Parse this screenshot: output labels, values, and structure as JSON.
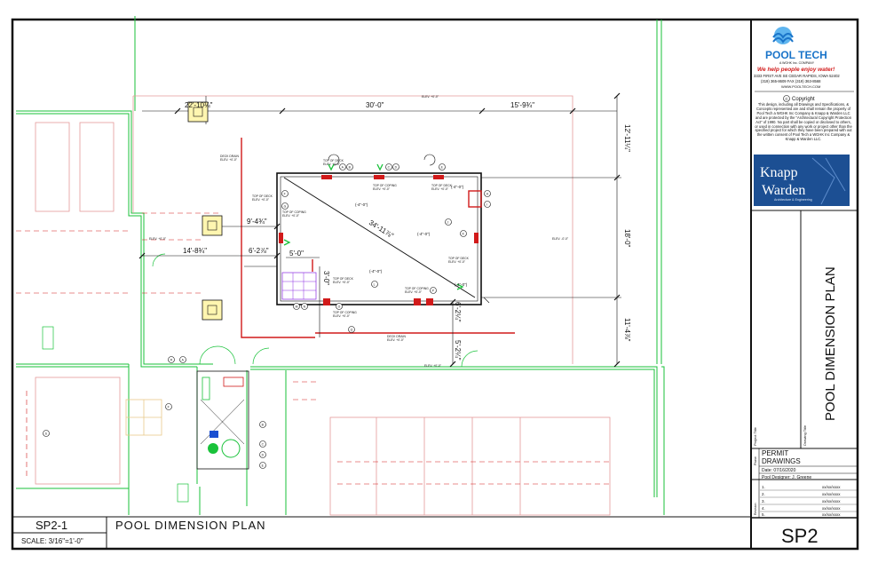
{
  "drawing": {
    "dims": {
      "top_a": "22'-10¼\"",
      "top_b": "30'-0\"",
      "top_c": "15'-9¾\"",
      "right_a": "12'-11¼\"",
      "right_b": "18'-0\"",
      "right_c": "11'-4⅞\"",
      "diag": "34'-11⅞\"",
      "left_a": "9'-4¾\"",
      "left_b": "14'-8¾\"",
      "left_c": "6'-2⅞\"",
      "step": "5'-0\"",
      "step2": "3'-0\"",
      "low_a": "6'-2¼\"",
      "low_b": "5'-2¼\""
    },
    "notes": {
      "top_of_coping": "TOP OF COPING",
      "top_of_deck": "TOP OF DECK",
      "deck_drain": "DECK DRAIN",
      "elev": "ELEV. +0'-0\"",
      "elev_neg": "ELEV. -0'-0\"",
      "elev_short": "ELEV. +0'-0\"",
      "slope": "(-4\"-0\")"
    },
    "callouts": [
      "A",
      "B",
      "C",
      "D",
      "E",
      "F",
      "G",
      "H",
      "I",
      "J",
      "K",
      "L",
      "M",
      "N",
      "O",
      "P",
      "Q",
      "R",
      "S"
    ]
  },
  "footer": {
    "sheet_ref": "SP2-1",
    "title": "POOL DIMENSION PLAN",
    "scale": "SCALE: 3/16\"=1'-0\""
  },
  "titleblock": {
    "logo_name": "POOL TECH",
    "logo_sub": "A WGHK Inc. COMPANY",
    "tagline": "We help people enjoy water!",
    "address": "3333 FIRST AVE SE CEDAR RAPIDS, IOWA 52402",
    "phone": "(319) 365-8609 FAX (319) 363-8568",
    "web": "WWW.POOLTECH.COM",
    "copyright_title": "Copyright",
    "copyright_text": "This design, including all Drawings and Specifications, & Concepts represented are and shall remain the property of Pool Tech a WGHK Inc Company & Knapp & Warden LLC and are protected by the \"Architectural Copyright Protection Act\" of 1990. No part shall be copied or disclosed to others, or used in connection with any work or project other than the specified project for which they have been prepared with out the written consent of Pool Tech a WGHK Inc Company & Knapp & Warden LLC.",
    "partner_line1": "Knapp",
    "partner_line2": "Warden",
    "partner_sub": "Architecture & Engineering",
    "project_title_label": "Project Title",
    "drawing_title_label": "Drawing Title",
    "drawing_title": "POOL DIMENSION PLAN",
    "phase_label": "Phase",
    "phase_line1": "PERMIT",
    "phase_line2": "DRAWINGS",
    "date": "Date: 07/16/2020",
    "designer": "Pool Designer: J. Greene",
    "revision_label": "Revision",
    "revisions": [
      {
        "num": "1.",
        "text": "xx/xx/xxxx"
      },
      {
        "num": "2.",
        "text": "xx/xx/xxxx"
      },
      {
        "num": "3.",
        "text": "xx/xx/xxxx"
      },
      {
        "num": "4.",
        "text": "xx/xx/xxxx"
      },
      {
        "num": "5.",
        "text": "xx/xx/xxxx"
      }
    ],
    "sheet_number": "SP2"
  },
  "colors": {
    "line": "#111111",
    "red": "#d11a1a",
    "green": "#19c23a",
    "pink": "#e59a9a",
    "partner_bg": "#1c4f93",
    "logo_blue": "#1a74c9"
  }
}
